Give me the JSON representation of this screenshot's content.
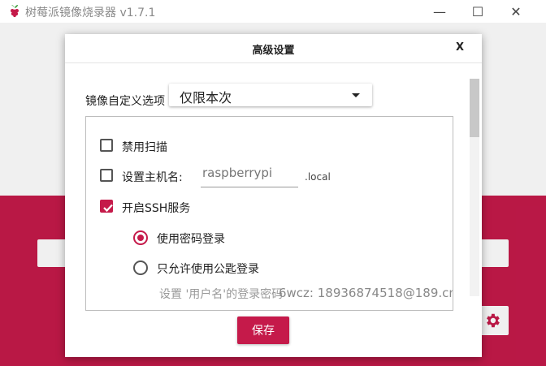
{
  "window": {
    "title": "树莓派镜像烧录器 v1.7.1",
    "logo_icon": "raspberry-logo-icon",
    "minimize_glyph": "—",
    "maximize_glyph": "☐",
    "close_glyph": "✕"
  },
  "colors": {
    "accent": "#c51a4a",
    "background_red": "#c51a4a"
  },
  "dialog": {
    "title": "高级设置",
    "close_label": "X",
    "image_option_label": "镜像自定义选项",
    "image_option_value": "仅限本次",
    "options": {
      "disable_scan": {
        "label": "禁用扫描",
        "checked": false
      },
      "set_hostname": {
        "label": "设置主机名:",
        "checked": false,
        "placeholder": "raspberrypi",
        "suffix": ".local"
      },
      "enable_ssh": {
        "label": "开启SSH服务",
        "checked": true
      }
    },
    "ssh_auth": {
      "password": {
        "label": "使用密码登录",
        "selected": true
      },
      "pubkey_only": {
        "label": "只允许使用公匙登录",
        "selected": false
      }
    },
    "partial_row_left": "设置 '用户名'的登录密码",
    "partial_row_right": "6wcz: 18936874518@189.cn",
    "save_label": "保存"
  }
}
